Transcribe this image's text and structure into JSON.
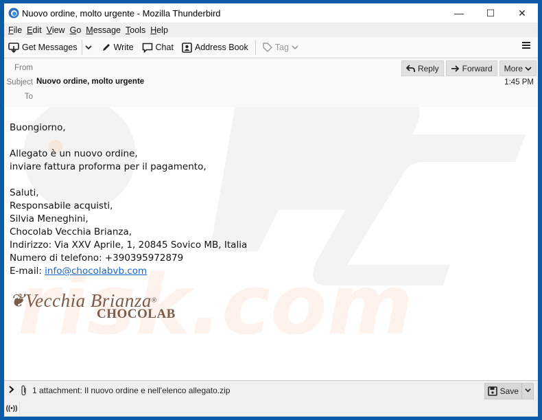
{
  "window": {
    "title": "Nuovo ordine, molto urgente - Mozilla Thunderbird",
    "controls": {
      "minimize": "—",
      "maximize": "☐",
      "close": "✕"
    }
  },
  "menubar": {
    "items": [
      {
        "label": "File",
        "accel": "F",
        "rest": "ile"
      },
      {
        "label": "Edit",
        "accel": "E",
        "rest": "dit"
      },
      {
        "label": "View",
        "accel": "V",
        "rest": "iew"
      },
      {
        "label": "Go",
        "accel": "G",
        "rest": "o"
      },
      {
        "label": "Message",
        "accel": "M",
        "rest": "essage"
      },
      {
        "label": "Tools",
        "accel": "T",
        "rest": "ools"
      },
      {
        "label": "Help",
        "accel": "H",
        "rest": "elp"
      }
    ]
  },
  "toolbar": {
    "get_messages": "Get Messages",
    "write": "Write",
    "chat": "Chat",
    "address_book": "Address Book",
    "tag": "Tag"
  },
  "header": {
    "from_label": "From",
    "from_value": "",
    "subject_label": "Subject",
    "subject_value": "Nuovo ordine, molto urgente",
    "to_label": "To",
    "to_value": "",
    "time": "1:45 PM",
    "reply": "Reply",
    "forward": "Forward",
    "more": "More"
  },
  "message": {
    "greeting": "Buongiorno,",
    "line1": "Allegato è un nuovo ordine,",
    "line2": "inviare fattura proforma per il pagamento,",
    "closing": "Saluti,",
    "role": "Responsabile acquisti,",
    "name": "Silvia Meneghini,",
    "company": "Chocolab Vecchia Brianza,",
    "address": "Indirizzo: Via XXV Aprile, 1, 20845 Sovico MB, Italia",
    "phone": "Numero di telefono: +390395972879",
    "email_label": "E-mail: ",
    "email": "info@chocolabvb.com",
    "logo_script": "Vecchia Brianza",
    "logo_reg": "®",
    "logo_sub": "CHOCOLAB"
  },
  "watermark": {
    "top": "PC",
    "bottom": "risk.com"
  },
  "attachment": {
    "summary": "1 attachment: Il nuovo ordine e nell'elenco allegato.zip",
    "save": "Save"
  },
  "status": {
    "live_icon": "((•))"
  },
  "colors": {
    "frame": "#0b5aa8",
    "link": "#1a66c9",
    "logo": "#7a5a48"
  }
}
